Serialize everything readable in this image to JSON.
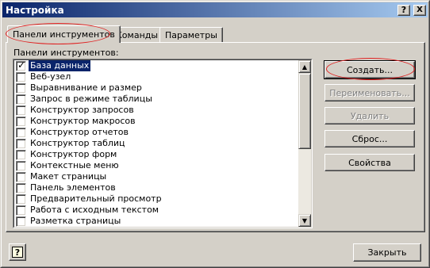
{
  "window": {
    "title": "Настройка"
  },
  "titlebar": {
    "help_glyph": "?",
    "close_glyph": "X"
  },
  "tabs": [
    {
      "label": "Панели инструментов",
      "active": true
    },
    {
      "label": "Команды",
      "active": false
    },
    {
      "label": "Параметры",
      "active": false
    }
  ],
  "toolbars_list": {
    "label": "Панели инструментов:",
    "items": [
      {
        "label": "База данных",
        "checked": true,
        "selected": true
      },
      {
        "label": "Веб-узел",
        "checked": false,
        "selected": false
      },
      {
        "label": "Выравнивание и размер",
        "checked": false,
        "selected": false
      },
      {
        "label": "Запрос в режиме таблицы",
        "checked": false,
        "selected": false
      },
      {
        "label": "Конструктор запросов",
        "checked": false,
        "selected": false
      },
      {
        "label": "Конструктор макросов",
        "checked": false,
        "selected": false
      },
      {
        "label": "Конструктор отчетов",
        "checked": false,
        "selected": false
      },
      {
        "label": "Конструктор таблиц",
        "checked": false,
        "selected": false
      },
      {
        "label": "Конструктор форм",
        "checked": false,
        "selected": false
      },
      {
        "label": "Контекстные меню",
        "checked": false,
        "selected": false
      },
      {
        "label": "Макет страницы",
        "checked": false,
        "selected": false
      },
      {
        "label": "Панель элементов",
        "checked": false,
        "selected": false
      },
      {
        "label": "Предварительный просмотр",
        "checked": false,
        "selected": false
      },
      {
        "label": "Работа с исходным текстом",
        "checked": false,
        "selected": false
      },
      {
        "label": "Разметка страницы",
        "checked": false,
        "selected": false
      }
    ]
  },
  "buttons": {
    "create": "Создать...",
    "rename": "Переименовать...",
    "delete": "Удалить",
    "reset": "Сброс...",
    "properties": "Свойства",
    "close": "Закрыть"
  },
  "help_button_glyph": "?",
  "colors": {
    "titlebar_start": "#0a246a",
    "titlebar_end": "#a6caf0",
    "selection": "#0a246a",
    "annotation": "#e02020",
    "face": "#d4d0c8"
  }
}
